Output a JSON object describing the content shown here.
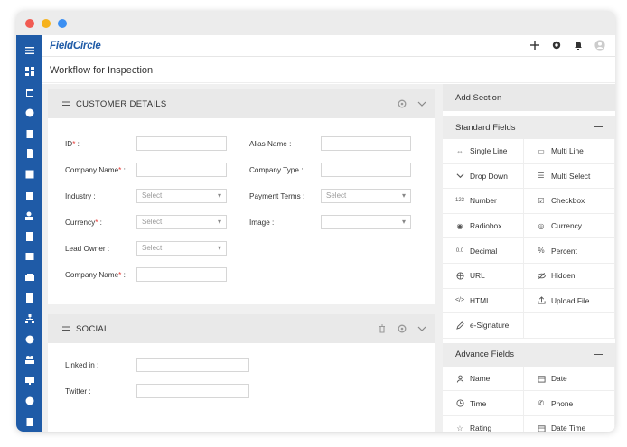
{
  "app": {
    "logo": "FieldCircle",
    "page_title": "Workflow for Inspection"
  },
  "customer_details": {
    "title": "CUSTOMER DETAILS",
    "fields": [
      {
        "label": "ID",
        "required": true,
        "type": "text",
        "value": ""
      },
      {
        "label": "Alias Name :",
        "required": false,
        "type": "text",
        "value": ""
      },
      {
        "label": "Company Name",
        "required": true,
        "type": "text",
        "value": ""
      },
      {
        "label": "Company Type :",
        "required": false,
        "type": "text",
        "value": ""
      },
      {
        "label": "Industry :",
        "required": false,
        "type": "select",
        "value": "Select"
      },
      {
        "label": "Payment Terms :",
        "required": false,
        "type": "select",
        "value": "Select"
      },
      {
        "label": "Currency",
        "required": true,
        "type": "select",
        "value": "Select"
      },
      {
        "label": "Image :",
        "required": false,
        "type": "select",
        "value": ""
      },
      {
        "label": "Lead Owner :",
        "required": false,
        "type": "select",
        "value": "Select"
      },
      {
        "label": "Company Name",
        "required": true,
        "type": "text",
        "value": ""
      }
    ]
  },
  "social": {
    "title": "SOCIAL",
    "fields": [
      {
        "label": "Linked in :",
        "value": ""
      },
      {
        "label": "Twitter :",
        "value": ""
      }
    ]
  },
  "right_panel": {
    "add_section": "Add Section",
    "standard_title": "Standard Fields",
    "standard_fields": [
      {
        "label": "Single Line",
        "icon": "single-line-icon"
      },
      {
        "label": "Multi Line",
        "icon": "multi-line-icon"
      },
      {
        "label": "Drop Down",
        "icon": "chevron-down-icon"
      },
      {
        "label": "Multi Select",
        "icon": "list-icon"
      },
      {
        "label": "Number",
        "icon": "number-icon"
      },
      {
        "label": "Checkbox",
        "icon": "checkbox-icon"
      },
      {
        "label": "Radiobox",
        "icon": "radio-icon"
      },
      {
        "label": "Currency",
        "icon": "currency-icon"
      },
      {
        "label": "Decimal",
        "icon": "decimal-icon"
      },
      {
        "label": "Percent",
        "icon": "percent-icon"
      },
      {
        "label": "URL",
        "icon": "globe-icon"
      },
      {
        "label": "Hidden",
        "icon": "eye-off-icon"
      },
      {
        "label": "HTML",
        "icon": "code-icon"
      },
      {
        "label": "Upload File",
        "icon": "upload-icon"
      },
      {
        "label": "e-Signature",
        "icon": "pen-icon"
      },
      {
        "label": "",
        "icon": ""
      }
    ],
    "advance_title": "Advance Fields",
    "advance_fields": [
      {
        "label": "Name",
        "icon": "user-icon"
      },
      {
        "label": "Date",
        "icon": "calendar-icon"
      },
      {
        "label": "Time",
        "icon": "clock-icon"
      },
      {
        "label": "Phone",
        "icon": "phone-icon"
      },
      {
        "label": "Rating",
        "icon": "star-icon"
      },
      {
        "label": "Date Time",
        "icon": "calendar-icon"
      }
    ]
  }
}
